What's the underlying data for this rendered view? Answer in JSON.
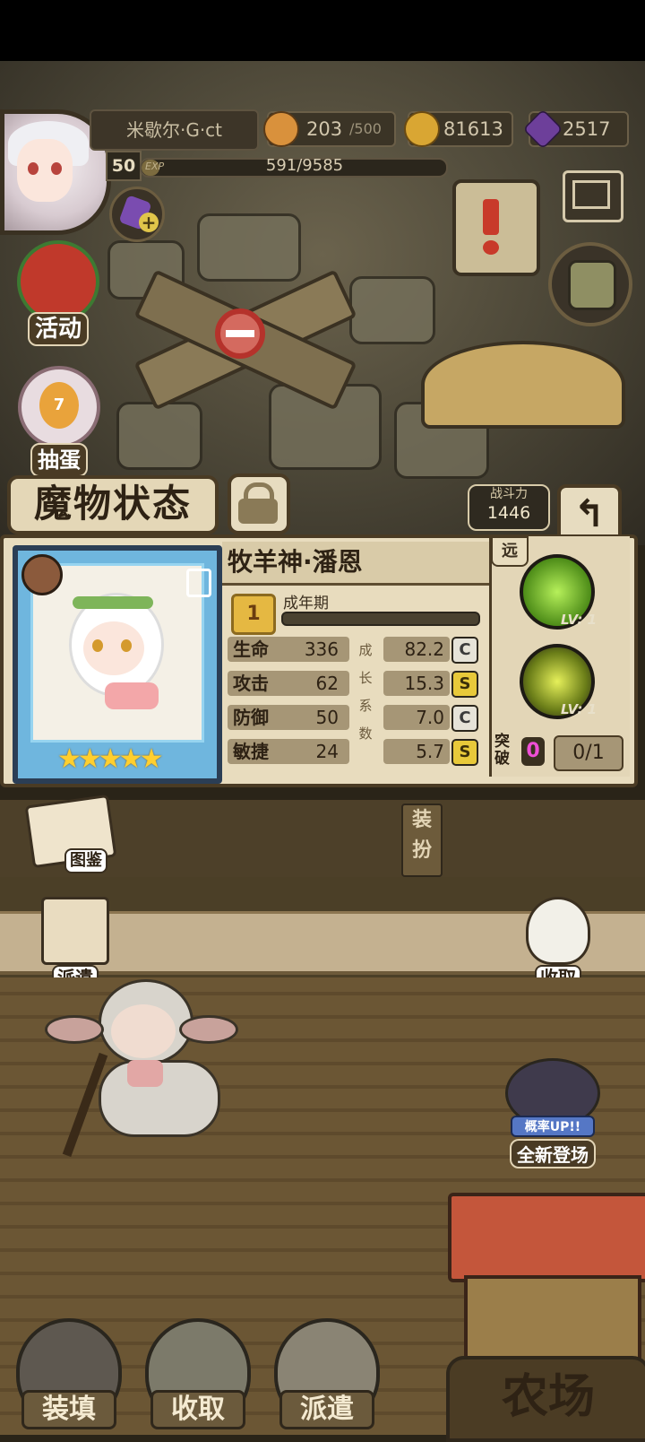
{
  "player": {
    "name": "米歇尔·G·ct",
    "level": "50",
    "exp_label": "EXP",
    "exp": "591/9585",
    "exp_progress": 0.0617
  },
  "resources": {
    "stamina_value": "203",
    "stamina_max": "/500",
    "gold": "81613",
    "gems": "2517"
  },
  "side_menu": {
    "activity": "活动",
    "egg_label": "抽蛋",
    "egg_count": "7"
  },
  "screen": {
    "title": "魔物状态",
    "power_label": "战斗力",
    "power_value": "1446"
  },
  "monster": {
    "name": "牧羊神·潘恩",
    "stage_number": "1",
    "stage": "成年期",
    "stars": 5,
    "range": "远",
    "stats": [
      {
        "label": "生命",
        "value": "336",
        "growth": "82.2",
        "grade": "C"
      },
      {
        "label": "攻击",
        "value": "62",
        "growth": "15.3",
        "grade": "S"
      },
      {
        "label": "防御",
        "value": "50",
        "growth": "7.0",
        "grade": "C"
      },
      {
        "label": "敏捷",
        "value": "24",
        "growth": "5.7",
        "grade": "S"
      }
    ],
    "growth_vertical": [
      "成",
      "长",
      "系",
      "数"
    ],
    "skills": [
      {
        "level": "LV: 1"
      },
      {
        "level": "LV: 1"
      }
    ],
    "breakthrough_label": "突破",
    "breakthrough_count": "0",
    "breakthrough_progress": "0/1"
  },
  "actions": {
    "encyclopedia": "图鉴",
    "equip": "装扮",
    "dispatch_left": "派遣",
    "collect_right": "收取",
    "event_badge": "概率UP!!",
    "event_label": "全新登场"
  },
  "bottom_nav": {
    "load": "装填",
    "collect": "收取",
    "dispatch": "派遣",
    "farm": "农场"
  },
  "colors": {
    "panel": "#e8dcbe",
    "frame": "#4a3b24",
    "grade_s": "#e8c93a",
    "grade_c": "#e6e3d8",
    "card_frame": "#6fb6de"
  }
}
